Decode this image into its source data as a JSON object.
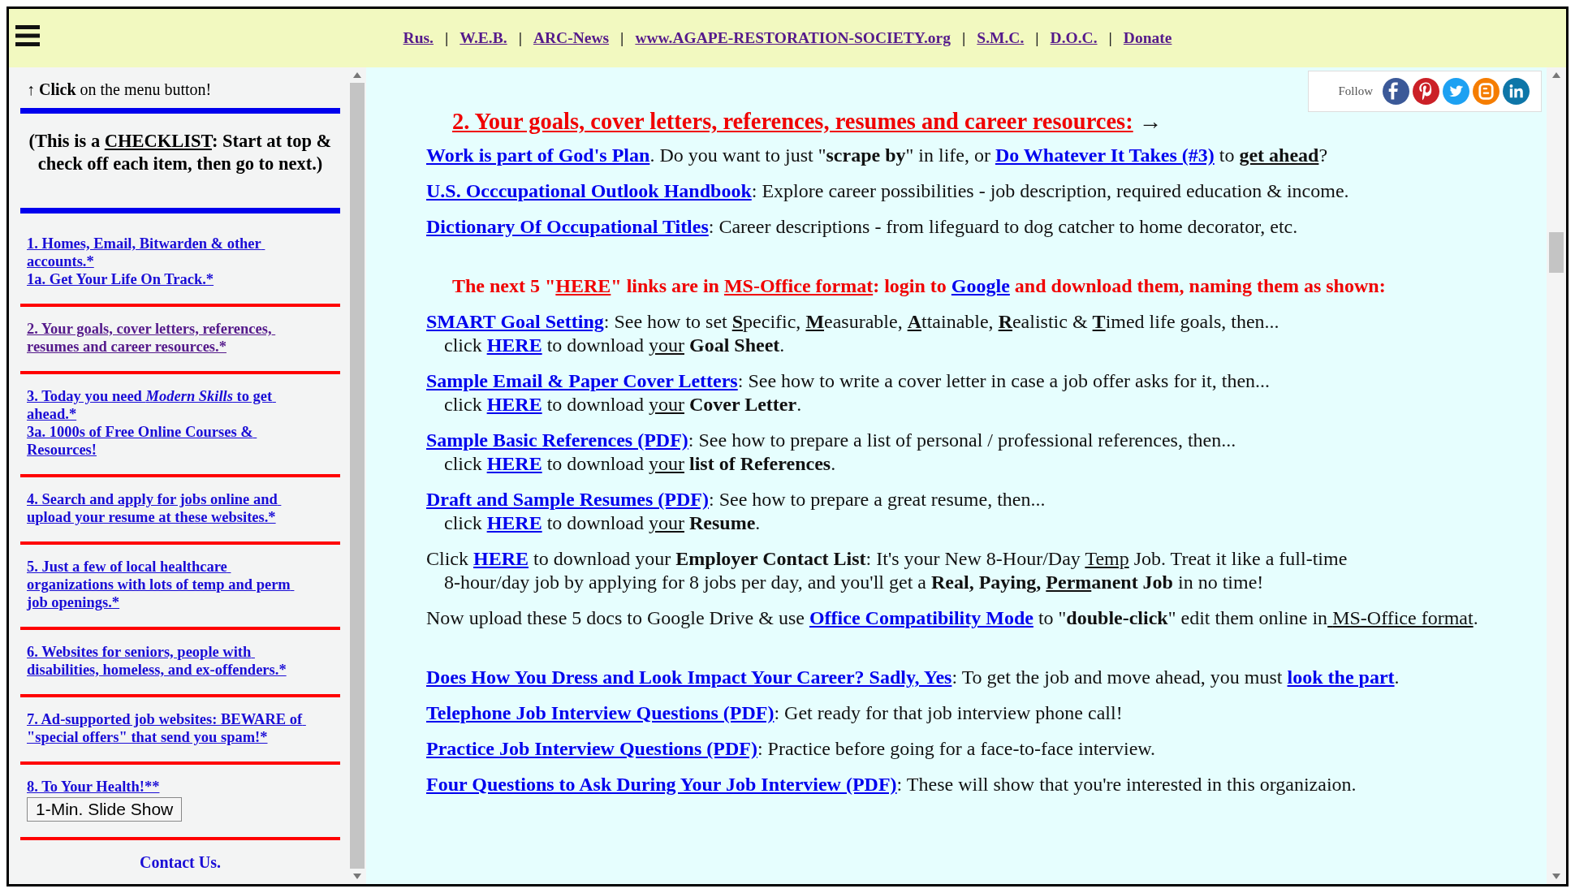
{
  "nav": [
    {
      "kind": "link",
      "text": "Rus.",
      "visited": true
    },
    {
      "kind": "separator",
      "text": "|"
    },
    {
      "kind": "link",
      "text": "W.E.B.",
      "visited": true
    },
    {
      "kind": "separator",
      "text": "|"
    },
    {
      "kind": "link",
      "text": "ARC-News",
      "visited": true
    },
    {
      "kind": "separator",
      "text": "|"
    },
    {
      "kind": "link",
      "text": "www.AGAPE-RESTORATION-SOCIETY.org",
      "visited": true
    },
    {
      "kind": "separator",
      "text": "|"
    },
    {
      "kind": "link",
      "text": "S.M.C.",
      "visited": true
    },
    {
      "kind": "separator",
      "text": "|"
    },
    {
      "kind": "link",
      "text": "D.O.C.",
      "visited": true
    },
    {
      "kind": "separator",
      "text": "|"
    },
    {
      "kind": "link",
      "text": "Donate",
      "visited": true
    }
  ],
  "sidebar": {
    "hint": [
      {
        "kind": "plain",
        "text": "↑ "
      },
      {
        "kind": "bold",
        "text": "Click"
      },
      {
        "kind": "plain",
        "text": " on the menu button!"
      }
    ],
    "checklist": [
      {
        "kind": "plain",
        "text": "(This is a "
      },
      {
        "kind": "underline",
        "text": "CHECKLIST"
      },
      {
        "kind": "plain",
        "text": ": Start at top & check off each item, then go to next.)"
      }
    ],
    "items": [
      {
        "links": [
          {
            "visited": false,
            "parts": [
              {
                "kind": "plain",
                "text": "1. Homes, Email, Bitwarden & other accounts.*"
              }
            ]
          },
          {
            "visited": false,
            "parts": [
              {
                "kind": "plain",
                "text": "1a. Get Your Life On Track.*"
              }
            ]
          }
        ]
      },
      {
        "links": [
          {
            "visited": true,
            "parts": [
              {
                "kind": "plain",
                "text": "2. Your goals, cover letters, references, resumes and career resources.*"
              }
            ]
          }
        ]
      },
      {
        "links": [
          {
            "visited": false,
            "parts": [
              {
                "kind": "plain",
                "text": "3. Today you need "
              },
              {
                "kind": "italic",
                "text": "Modern Skills"
              },
              {
                "kind": "plain",
                "text": " to get ahead.*"
              }
            ]
          },
          {
            "visited": false,
            "parts": [
              {
                "kind": "plain",
                "text": "3a. 1000s of Free Online Courses & Resources!"
              }
            ]
          }
        ]
      },
      {
        "links": [
          {
            "visited": false,
            "parts": [
              {
                "kind": "plain",
                "text": "4. Search and apply for jobs online and upload your resume at these websites.*"
              }
            ]
          }
        ]
      },
      {
        "links": [
          {
            "visited": false,
            "parts": [
              {
                "kind": "plain",
                "text": "5. Just a few of local healthcare organizations with lots of temp and perm job openings.*"
              }
            ]
          }
        ]
      },
      {
        "links": [
          {
            "visited": false,
            "parts": [
              {
                "kind": "plain",
                "text": "6. Websites for seniors, people with disabilities, homeless, and ex-offenders.*"
              }
            ]
          }
        ]
      },
      {
        "links": [
          {
            "visited": false,
            "parts": [
              {
                "kind": "plain",
                "text": "7. Ad-supported job websites: BEWARE of \"special offers\" that send you spam!*"
              }
            ]
          }
        ]
      },
      {
        "links": [
          {
            "visited": false,
            "parts": [
              {
                "kind": "plain",
                "text": "8. To Your Health!**"
              }
            ]
          }
        ],
        "button": "1-Min. Slide Show"
      }
    ],
    "contact": {
      "text": "Contact Us.",
      "visited": false
    }
  },
  "follow": {
    "label": "Follow",
    "icons": [
      {
        "kind": "facebook",
        "color": "#3b5998"
      },
      {
        "kind": "pinterest",
        "color": "#cb2027"
      },
      {
        "kind": "twitter",
        "color": "#1da1f2"
      },
      {
        "kind": "blogger",
        "color": "#f57d00"
      },
      {
        "kind": "linkedin",
        "color": "#0e76a8"
      }
    ]
  },
  "sections": [
    {
      "paragraphs": [
        {
          "kind": "heading",
          "segments": [
            {
              "kind": "link",
              "text": "2. Your goals, cover letters, references, resumes and career resources:"
            },
            {
              "kind": "plain",
              "text": " →"
            }
          ]
        },
        {
          "kind": "body",
          "segments": [
            {
              "kind": "link",
              "text": "Work is part of God's Plan"
            },
            {
              "kind": "plain",
              "text": ". Do you want to just \""
            },
            {
              "kind": "bold",
              "text": "scrape by"
            },
            {
              "kind": "plain",
              "text": "\" in life, or "
            },
            {
              "kind": "link",
              "text": "Do Whatever It Takes (#3)"
            },
            {
              "kind": "plain",
              "text": " to "
            },
            {
              "kind": "bold-underline",
              "text": "get ahead"
            },
            {
              "kind": "plain",
              "text": "?"
            }
          ]
        },
        {
          "kind": "body",
          "segments": [
            {
              "kind": "link",
              "text": "U.S. Occcupational Outlook Handbook"
            },
            {
              "kind": "plain",
              "text": ": Explore career possibilities - job description, required education & income."
            }
          ]
        },
        {
          "kind": "body",
          "segments": [
            {
              "kind": "link",
              "text": "Dictionary Of Occupational Titles"
            },
            {
              "kind": "plain",
              "text": ": Career descriptions - from lifeguard to dog catcher to home decorator, etc."
            }
          ]
        }
      ]
    },
    {
      "paragraphs": [
        {
          "kind": "notice",
          "segments": [
            {
              "kind": "plain",
              "text": "The next 5 \""
            },
            {
              "kind": "underline",
              "text": "HERE"
            },
            {
              "kind": "plain",
              "text": "\" links are in "
            },
            {
              "kind": "underline",
              "text": "MS-Office format"
            },
            {
              "kind": "plain",
              "text": ": login to "
            },
            {
              "kind": "link",
              "text": "Google"
            },
            {
              "kind": "plain",
              "text": " and download them, naming them as shown:"
            }
          ]
        },
        {
          "kind": "hanging",
          "segments": [
            {
              "kind": "link",
              "text": "SMART Goal Setting"
            },
            {
              "kind": "plain",
              "text": ": See how to set "
            },
            {
              "kind": "bold-underline",
              "text": "S"
            },
            {
              "kind": "plain",
              "text": "pecific, "
            },
            {
              "kind": "bold-underline",
              "text": "M"
            },
            {
              "kind": "plain",
              "text": "easurable, "
            },
            {
              "kind": "bold-underline",
              "text": "A"
            },
            {
              "kind": "plain",
              "text": "ttainable, "
            },
            {
              "kind": "bold-underline",
              "text": "R"
            },
            {
              "kind": "plain",
              "text": "ealistic & "
            },
            {
              "kind": "bold-underline",
              "text": "T"
            },
            {
              "kind": "plain",
              "text": "imed life goals, then..."
            },
            {
              "kind": "break"
            },
            {
              "kind": "plain",
              "text": "click "
            },
            {
              "kind": "link",
              "text": "HERE"
            },
            {
              "kind": "plain",
              "text": " to download "
            },
            {
              "kind": "underline",
              "text": "your"
            },
            {
              "kind": "bold",
              "text": " Goal Sheet"
            },
            {
              "kind": "plain",
              "text": "."
            }
          ]
        },
        {
          "kind": "hanging",
          "segments": [
            {
              "kind": "link",
              "text": "Sample Email & Paper Cover Letters"
            },
            {
              "kind": "plain",
              "text": ": See how to write a cover letter in case a job offer asks for it, then..."
            },
            {
              "kind": "break"
            },
            {
              "kind": "plain",
              "text": "click "
            },
            {
              "kind": "link",
              "text": "HERE"
            },
            {
              "kind": "plain",
              "text": " to download "
            },
            {
              "kind": "underline",
              "text": "your"
            },
            {
              "kind": "bold",
              "text": " Cover Letter"
            },
            {
              "kind": "plain",
              "text": "."
            }
          ]
        },
        {
          "kind": "hanging",
          "segments": [
            {
              "kind": "link",
              "text": "Sample Basic References (PDF)"
            },
            {
              "kind": "plain",
              "text": ": See how to prepare a list of personal / professional references, then..."
            },
            {
              "kind": "break"
            },
            {
              "kind": "plain",
              "text": "click "
            },
            {
              "kind": "link",
              "text": "HERE"
            },
            {
              "kind": "plain",
              "text": " to download "
            },
            {
              "kind": "underline",
              "text": "your"
            },
            {
              "kind": "bold",
              "text": " list of References"
            },
            {
              "kind": "plain",
              "text": "."
            }
          ]
        },
        {
          "kind": "hanging",
          "segments": [
            {
              "kind": "link",
              "text": "Draft and Sample Resumes (PDF)"
            },
            {
              "kind": "plain",
              "text": ": See how to prepare a great resume, then..."
            },
            {
              "kind": "break"
            },
            {
              "kind": "plain",
              "text": "click "
            },
            {
              "kind": "link",
              "text": "HERE"
            },
            {
              "kind": "plain",
              "text": " to download "
            },
            {
              "kind": "underline",
              "text": "your"
            },
            {
              "kind": "bold",
              "text": " Resume"
            },
            {
              "kind": "plain",
              "text": "."
            }
          ]
        },
        {
          "kind": "hanging",
          "segments": [
            {
              "kind": "plain",
              "text": "Click "
            },
            {
              "kind": "link",
              "text": "HERE"
            },
            {
              "kind": "plain",
              "text": " to download your "
            },
            {
              "kind": "bold",
              "text": "Employer Contact List"
            },
            {
              "kind": "plain",
              "text": ": It's your New 8-Hour/Day "
            },
            {
              "kind": "underline",
              "text": "Temp"
            },
            {
              "kind": "plain",
              "text": " Job. Treat it like a full-time"
            },
            {
              "kind": "break"
            },
            {
              "kind": "plain",
              "text": "8-hour/day job by applying for 8 jobs per day, and you'll get a "
            },
            {
              "kind": "bold",
              "text": "Real, Paying, "
            },
            {
              "kind": "bold-underline",
              "text": "Perm"
            },
            {
              "kind": "bold",
              "text": "anent Job"
            },
            {
              "kind": "plain",
              "text": " in no time!"
            }
          ]
        },
        {
          "kind": "body",
          "segments": [
            {
              "kind": "plain",
              "text": "Now upload these 5 docs to Google Drive & use "
            },
            {
              "kind": "link",
              "text": "Office Compatibility Mode"
            },
            {
              "kind": "plain",
              "text": " to \""
            },
            {
              "kind": "bold",
              "text": "double-click"
            },
            {
              "kind": "plain",
              "text": "\" edit them online in"
            },
            {
              "kind": "underline",
              "text": " MS-Office format"
            },
            {
              "kind": "plain",
              "text": "."
            }
          ]
        }
      ]
    },
    {
      "paragraphs": [
        {
          "kind": "body",
          "segments": [
            {
              "kind": "link",
              "text": "Does How You Dress and Look Impact Your Career? Sadly, Yes"
            },
            {
              "kind": "plain",
              "text": ": To get the job and move ahead, you must "
            },
            {
              "kind": "link",
              "text": "look the part"
            },
            {
              "kind": "plain",
              "text": "."
            }
          ]
        },
        {
          "kind": "body",
          "segments": [
            {
              "kind": "link",
              "text": "Telephone Job Interview Questions (PDF)"
            },
            {
              "kind": "plain",
              "text": ": Get ready for that job interview phone call!"
            }
          ]
        },
        {
          "kind": "body",
          "segments": [
            {
              "kind": "link",
              "text": "Practice Job Interview Questions (PDF)"
            },
            {
              "kind": "plain",
              "text": ": Practice before going for a face-to-face interview."
            }
          ]
        },
        {
          "kind": "body",
          "segments": [
            {
              "kind": "link",
              "text": "Four Questions to Ask During Your Job Interview (PDF)"
            },
            {
              "kind": "plain",
              "text": ": These will show that you're interested in this organizaion."
            }
          ]
        }
      ]
    }
  ]
}
